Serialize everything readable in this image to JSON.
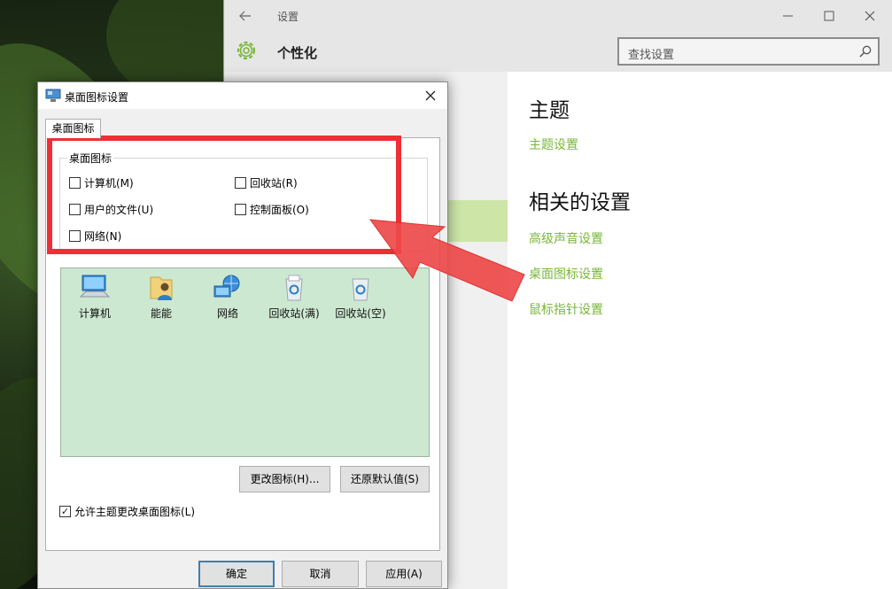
{
  "settings": {
    "window_title": "设置",
    "header_title": "个性化",
    "search_placeholder": "查找设置",
    "sections": {
      "theme_title": "主题",
      "theme_link": "主题设置",
      "related_title": "相关的设置",
      "related_links": [
        "高级声音设置",
        "桌面图标设置",
        "鼠标指针设置"
      ]
    },
    "accent_color": "#79b63c",
    "selected_nav_color": "#cde6a8"
  },
  "dialog": {
    "title": "桌面图标设置",
    "tab": "桌面图标",
    "group_label": "桌面图标",
    "checkboxes": [
      {
        "label": "计算机(M)",
        "checked": false
      },
      {
        "label": "回收站(R)",
        "checked": false
      },
      {
        "label": "用户的文件(U)",
        "checked": false
      },
      {
        "label": "控制面板(O)",
        "checked": false
      },
      {
        "label": "网络(N)",
        "checked": false
      }
    ],
    "icons": [
      {
        "label": "计算机",
        "icon": "computer-icon"
      },
      {
        "label": "能能",
        "icon": "user-folder-icon"
      },
      {
        "label": "网络",
        "icon": "network-icon"
      },
      {
        "label": "回收站(满)",
        "icon": "recycle-bin-full-icon"
      },
      {
        "label": "回收站(空)",
        "icon": "recycle-bin-empty-icon"
      }
    ],
    "change_icon_button": "更改图标(H)...",
    "restore_default_button": "还原默认值(S)",
    "allow_theme_label": "允许主题更改桌面图标(L)",
    "allow_theme_checked": true,
    "ok_button": "确定",
    "cancel_button": "取消",
    "apply_button": "应用(A)"
  },
  "annotation_color": "#ee2f36"
}
